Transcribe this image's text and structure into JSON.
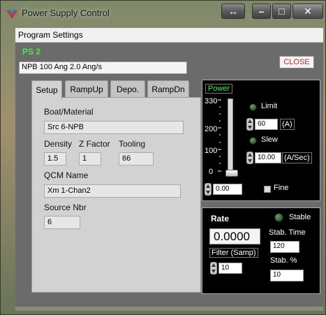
{
  "window": {
    "title": "Power Supply Control",
    "buttons": {
      "restore": "↔",
      "minimize": "–",
      "maximize": "□",
      "close": "✕"
    }
  },
  "menu": {
    "items": [
      "Program Settings"
    ]
  },
  "header": {
    "ps_label": "PS 2",
    "description": "NPB 100 Ang 2.0 Ang/s",
    "close_label": "CLOSE"
  },
  "tabs": [
    {
      "label": "Setup",
      "active": true
    },
    {
      "label": "RampUp",
      "active": false
    },
    {
      "label": "Depo.",
      "active": false
    },
    {
      "label": "RampDn",
      "active": false
    }
  ],
  "setup": {
    "boat_label": "Boat/Material",
    "boat_value": "Src 6-NPB",
    "density_label": "Density",
    "density_value": "1.5",
    "zfactor_label": "Z Factor",
    "zfactor_value": "1",
    "tooling_label": "Tooling",
    "tooling_value": "66",
    "qcm_label": "QCM Name",
    "qcm_value": "Xm 1-Chan2",
    "source_label": "Source Nbr",
    "source_value": "6"
  },
  "power": {
    "title": "Power",
    "ticks": [
      "330",
      "200",
      "100",
      "0"
    ],
    "limit_label": "Limit",
    "limit_value": "60",
    "limit_unit": "(A)",
    "slew_label": "Slew",
    "slew_value": "10.00",
    "slew_unit": "(A/Sec)",
    "output_value": "0.00",
    "fine_label": "Fine",
    "slider_level": 0.0
  },
  "rate": {
    "title": "Rate",
    "stable_label": "Stable",
    "rate_value": "0.0000",
    "stab_time_label": "Stab. Time",
    "stab_time_value": "120",
    "filter_label": "Filter (Samp)",
    "filter_value": "10",
    "stab_pct_label": "Stab. %",
    "stab_pct_value": "10"
  },
  "colors": {
    "green_text": "#3cf03c",
    "close_text": "#dd2222",
    "panel_black": "#000000"
  }
}
